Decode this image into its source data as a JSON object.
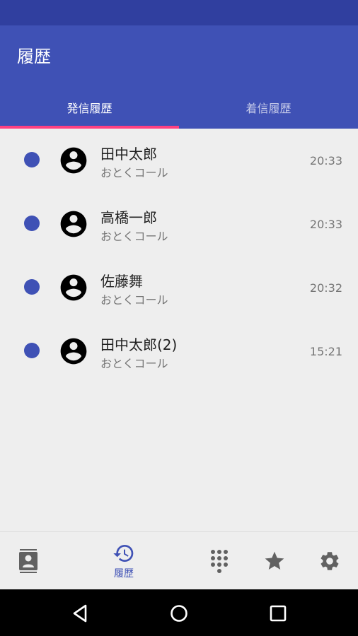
{
  "app": {
    "title": "履歴"
  },
  "tabs": [
    {
      "label": "発信履歴",
      "active": true
    },
    {
      "label": "着信履歴",
      "active": false
    }
  ],
  "history": [
    {
      "name": "田中太郎",
      "type": "おとくコール",
      "time": "20:33"
    },
    {
      "name": "高橋一郎",
      "type": "おとくコール",
      "time": "20:33"
    },
    {
      "name": "佐藤舞",
      "type": "おとくコール",
      "time": "20:32"
    },
    {
      "name": "田中太郎(2)",
      "type": "おとくコール",
      "time": "15:21"
    }
  ],
  "bottom_nav": {
    "items": [
      {
        "icon": "contacts-icon"
      },
      {
        "icon": "history-icon",
        "label": "履歴",
        "active": true
      },
      {
        "icon": "dialpad-icon"
      },
      {
        "icon": "star-icon"
      },
      {
        "icon": "gear-icon"
      }
    ]
  },
  "system_nav": {
    "icons": [
      "back-icon",
      "home-icon",
      "recents-icon"
    ]
  },
  "colors": {
    "primary": "#3f51b5",
    "primary_dark": "#303f9f",
    "accent": "#ff4081",
    "background": "#eeeeee"
  }
}
